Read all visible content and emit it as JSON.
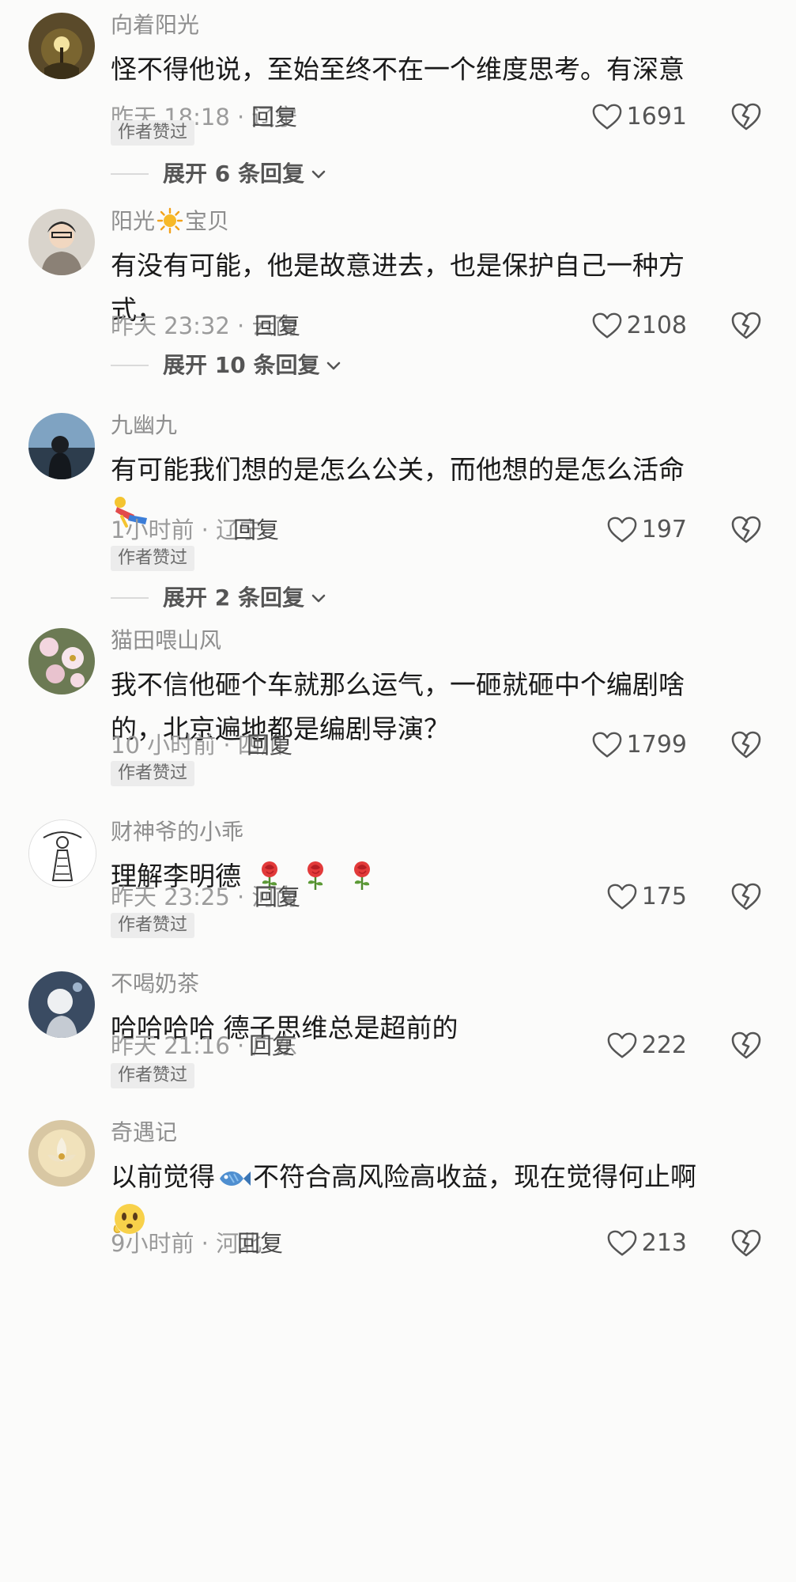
{
  "comments": [
    {
      "user": "向着阳光",
      "text": "怪不得他说，至始至终不在一个维度思考。有深意",
      "time": "昨天 18:18 · 辽宁",
      "reply": "回复",
      "likes": "1691",
      "badge": "作者赞过",
      "expand": "展开 6 条回复"
    },
    {
      "user_a": "阳光",
      "user_b": "宝贝",
      "text": "有没有可能，他是故意进去，也是保护自己一种方式，",
      "time": "昨天 23:32 · 云南",
      "reply": "回复",
      "likes": "2108",
      "expand": "展开 10 条回复"
    },
    {
      "user": "九幽九",
      "text": "有可能我们想的是怎么公关，而他想的是怎么活命",
      "time": "1小时前 · 辽宁",
      "reply": "回复",
      "likes": "197",
      "badge": "作者赞过",
      "expand": "展开 2 条回复"
    },
    {
      "user": "猫田喂山风",
      "text": "我不信他砸个车就那么运气，一砸就砸中个编剧啥的，北京遍地都是编剧导演？",
      "time": "10 小时前 · 四川",
      "reply": "回复",
      "likes": "1799",
      "badge": "作者赞过"
    },
    {
      "user": "财神爷的小乖",
      "text": "理解李明德",
      "time": "昨天 23:25 · 河南",
      "reply": "回复",
      "likes": "175",
      "badge": "作者赞过"
    },
    {
      "user": "不喝奶茶",
      "text": "哈哈哈哈 德子思维总是超前的",
      "time": "昨天 21:16 · 广东",
      "reply": "回复",
      "likes": "222",
      "badge": "作者赞过"
    },
    {
      "user": "奇遇记",
      "text_a": "以前觉得",
      "text_b": "不符合高风险高收益，现在觉得何止啊",
      "time": "9小时前 · 河北",
      "reply": "回复",
      "likes": "213"
    }
  ],
  "icons": {
    "like": "heart-outline-icon",
    "dislike": "broken-heart-icon",
    "expand": "chevron-down-icon"
  },
  "colors": {
    "background": "#fbfbfa",
    "username": "#8e8e8e",
    "meta": "#9b9b9b",
    "badge_bg": "#ececec"
  }
}
